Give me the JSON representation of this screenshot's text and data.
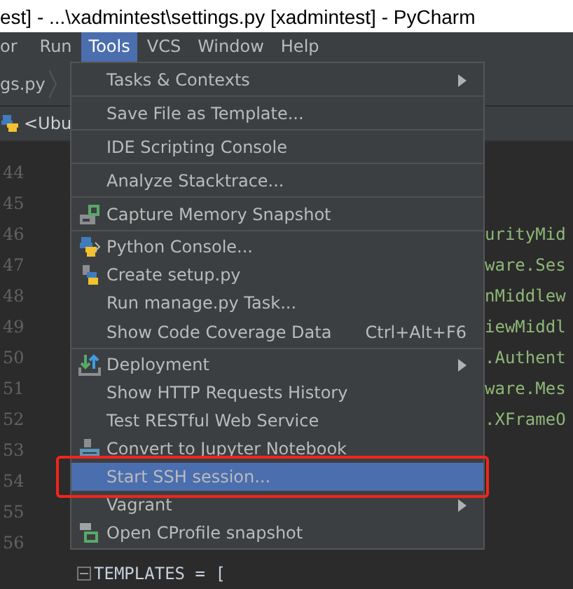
{
  "window": {
    "title": "est] - ...\\xadmintest\\settings.py [xadmintest] - PyCharm"
  },
  "menu_bar": [
    {
      "label": "or",
      "selected": false
    },
    {
      "label": "Run",
      "selected": false
    },
    {
      "label": "Tools",
      "selected": true
    },
    {
      "label": "VCS",
      "selected": false
    },
    {
      "label": "Window",
      "selected": false
    },
    {
      "label": "Help",
      "selected": false
    }
  ],
  "breadcrumb": "gs.py",
  "run_config": "<Ubu",
  "editor": {
    "lines": [
      {
        "number": "44"
      },
      {
        "number": "45"
      },
      {
        "number": "46",
        "code": "urityMid"
      },
      {
        "number": "47",
        "code": "ware.Ses"
      },
      {
        "number": "48",
        "code": "nMiddlew"
      },
      {
        "number": "49",
        "code": "iewMiddl"
      },
      {
        "number": "50",
        "code": ".Authent"
      },
      {
        "number": "51",
        "code": "ware.Mes"
      },
      {
        "number": "52",
        "code": ".XFrameO"
      },
      {
        "number": "53"
      },
      {
        "number": "54"
      },
      {
        "number": "55"
      },
      {
        "number": "56"
      }
    ],
    "last_line": "TEMPLATES = ["
  },
  "tools_menu": [
    {
      "label": "Tasks & Contexts",
      "submenu": true,
      "separator_after": true,
      "selected": false
    },
    {
      "label": "Save File as Template...",
      "submenu": false,
      "separator_after": true,
      "selected": false
    },
    {
      "label": "IDE Scripting Console",
      "submenu": false,
      "separator_after": true,
      "selected": false
    },
    {
      "label": "Analyze Stacktrace...",
      "submenu": false,
      "separator_after": true,
      "selected": false
    },
    {
      "label": "Capture Memory Snapshot",
      "submenu": false,
      "separator_after": true,
      "selected": false
    },
    {
      "label": "Python Console...",
      "submenu": false,
      "separator_after": false,
      "selected": false
    },
    {
      "label": "Create setup.py",
      "submenu": false,
      "separator_after": false,
      "selected": false
    },
    {
      "label": "Run manage.py Task...",
      "submenu": false,
      "separator_after": false,
      "selected": false
    },
    {
      "label": "Show Code Coverage Data",
      "shortcut": "Ctrl+Alt+F6",
      "submenu": false,
      "separator_after": true,
      "selected": false
    },
    {
      "label": "Deployment",
      "submenu": true,
      "separator_after": false,
      "selected": false
    },
    {
      "label": "Show HTTP Requests History",
      "submenu": false,
      "separator_after": false,
      "selected": false
    },
    {
      "label": "Test RESTful Web Service",
      "submenu": false,
      "separator_after": false,
      "selected": false
    },
    {
      "label": "Convert to Jupyter Notebook",
      "submenu": false,
      "separator_after": false,
      "selected": false
    },
    {
      "label": "Start SSH session...",
      "submenu": false,
      "separator_after": false,
      "selected": true
    },
    {
      "label": "Vagrant",
      "submenu": true,
      "separator_after": false,
      "selected": false
    },
    {
      "label": "Open CProfile snapshot",
      "submenu": false,
      "separator_after": false,
      "selected": false
    }
  ]
}
